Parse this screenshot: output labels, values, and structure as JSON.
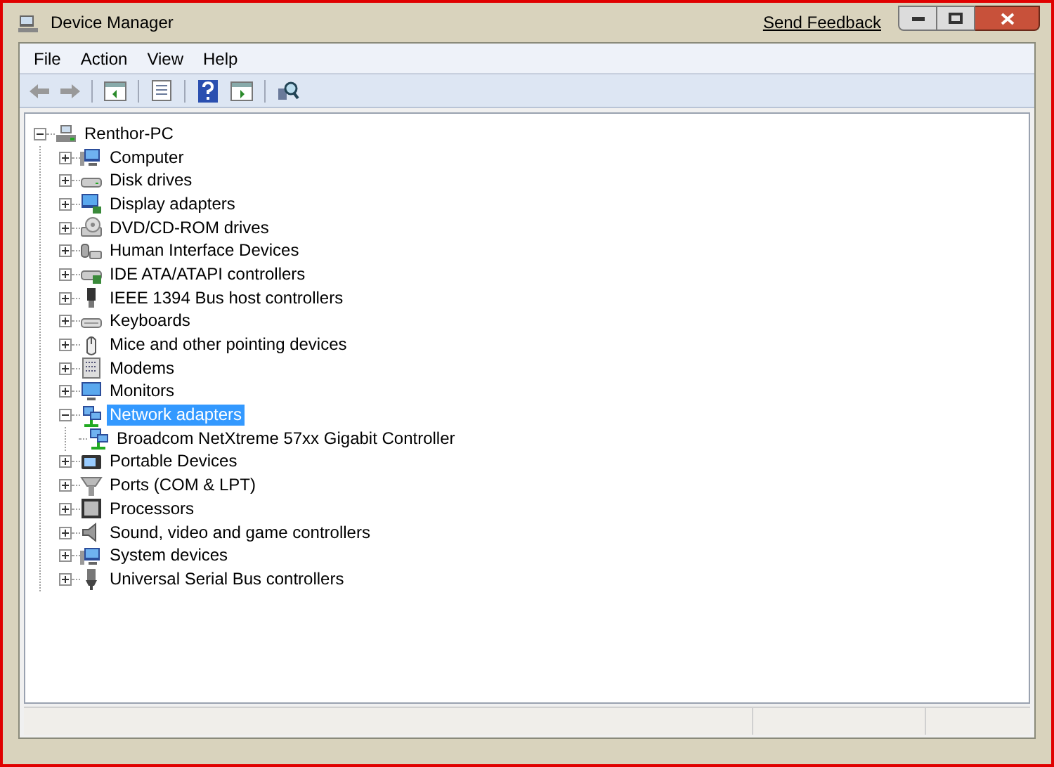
{
  "window": {
    "title": "Device Manager",
    "send_feedback": "Send Feedback"
  },
  "menu": [
    "File",
    "Action",
    "View",
    "Help"
  ],
  "tree": {
    "label": "Renthor-PC",
    "expanded": true,
    "selected": false,
    "children": [
      {
        "label": "Computer",
        "expanded": false,
        "selected": false
      },
      {
        "label": "Disk drives",
        "expanded": false,
        "selected": false
      },
      {
        "label": "Display adapters",
        "expanded": false,
        "selected": false
      },
      {
        "label": "DVD/CD-ROM drives",
        "expanded": false,
        "selected": false
      },
      {
        "label": "Human Interface Devices",
        "expanded": false,
        "selected": false
      },
      {
        "label": "IDE ATA/ATAPI controllers",
        "expanded": false,
        "selected": false
      },
      {
        "label": "IEEE 1394 Bus host controllers",
        "expanded": false,
        "selected": false
      },
      {
        "label": "Keyboards",
        "expanded": false,
        "selected": false
      },
      {
        "label": "Mice and other pointing devices",
        "expanded": false,
        "selected": false
      },
      {
        "label": "Modems",
        "expanded": false,
        "selected": false
      },
      {
        "label": "Monitors",
        "expanded": false,
        "selected": false
      },
      {
        "label": "Network adapters",
        "expanded": true,
        "selected": true,
        "children": [
          {
            "label": "Broadcom NetXtreme 57xx Gigabit Controller",
            "selected": false
          }
        ]
      },
      {
        "label": "Portable Devices",
        "expanded": false,
        "selected": false
      },
      {
        "label": "Ports (COM & LPT)",
        "expanded": false,
        "selected": false
      },
      {
        "label": "Processors",
        "expanded": false,
        "selected": false
      },
      {
        "label": "Sound, video and game controllers",
        "expanded": false,
        "selected": false
      },
      {
        "label": "System devices",
        "expanded": false,
        "selected": false
      },
      {
        "label": "Universal Serial Bus controllers",
        "expanded": false,
        "selected": false
      }
    ]
  }
}
